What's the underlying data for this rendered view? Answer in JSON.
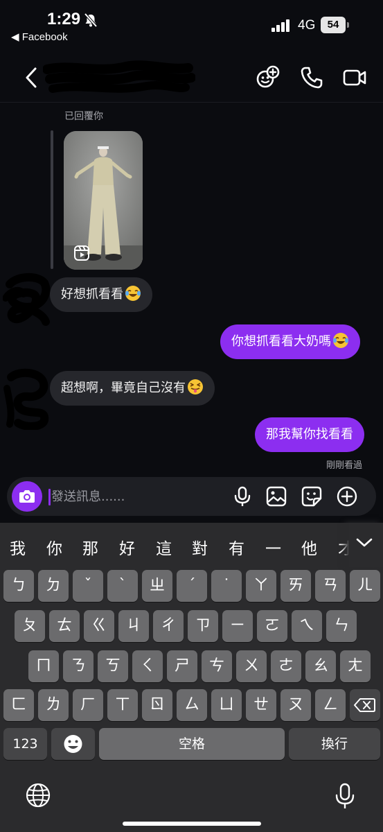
{
  "status_bar": {
    "time": "1:29",
    "back_app": "◀ Facebook",
    "network": "4G",
    "battery": "54"
  },
  "header": {
    "icons": [
      "add-people-icon",
      "phone-icon",
      "video-icon"
    ]
  },
  "conversation": {
    "reply_label": "已回覆你",
    "messages": [
      {
        "sender": "them",
        "text": "好想抓看看"
      },
      {
        "sender": "me",
        "text": "你想抓看看大奶嗎"
      },
      {
        "sender": "them",
        "text": "超想啊，畢竟自己沒有"
      },
      {
        "sender": "me",
        "text": "那我幫你找看看"
      }
    ],
    "seen_status": "剛剛看過"
  },
  "composer": {
    "placeholder": "發送訊息......",
    "icons": [
      "camera-icon",
      "microphone-icon",
      "image-icon",
      "sticker-icon",
      "add-icon"
    ]
  },
  "keyboard": {
    "candidates": [
      "我",
      "你",
      "那",
      "好",
      "這",
      "對",
      "有",
      "一",
      "他",
      "才"
    ],
    "row1": [
      "ㄅ",
      "ㄉ",
      "ˇ",
      "ˋ",
      "ㄓ",
      "ˊ",
      "˙",
      "ㄚ",
      "ㄞ",
      "ㄢ",
      "ㄦ"
    ],
    "row2": [
      "ㄆ",
      "ㄊ",
      "ㄍ",
      "ㄐ",
      "ㄔ",
      "ㄗ",
      "ㄧ",
      "ㄛ",
      "ㄟ",
      "ㄣ"
    ],
    "row3": [
      "ㄇ",
      "ㄋ",
      "ㄎ",
      "ㄑ",
      "ㄕ",
      "ㄘ",
      "ㄨ",
      "ㄜ",
      "ㄠ",
      "ㄤ"
    ],
    "row4": [
      "ㄈ",
      "ㄌ",
      "ㄏ",
      "ㄒ",
      "ㄖ",
      "ㄙ",
      "ㄩ",
      "ㄝ",
      "ㄡ",
      "ㄥ"
    ],
    "numbers_key": "123",
    "space_key": "空格",
    "return_key": "換行"
  },
  "colors": {
    "accent": "#8c2ef0",
    "background": "#0b0c10",
    "incoming_bubble": "#26272c",
    "keyboard_bg": "#2b2b2d",
    "key": "#6b6b6d",
    "key_dark": "#454547"
  }
}
